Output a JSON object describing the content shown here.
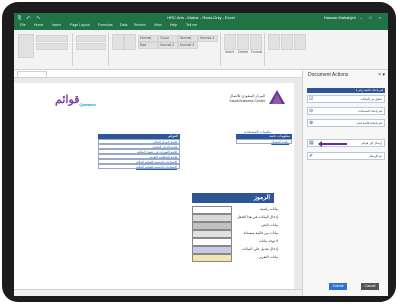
{
  "titlebar": {
    "title": "HRC Arts - Mahar - Read-Only - Excel",
    "user": "Hassan Mahabjeh",
    "qat": "⎘ ↶ ↷",
    "window_controls": "– □ ×"
  },
  "tabs": [
    "File",
    "Home",
    "Insert",
    "Page Layout",
    "Formulas",
    "Data",
    "Review",
    "View",
    "Help",
    "Tell me"
  ],
  "ribbon": {
    "style_boxes": [
      "Normal",
      "Bad",
      "Good",
      "Normal 2",
      "Normal",
      "Normal 3",
      "Normal 4"
    ],
    "cells_group": [
      "Insert",
      "Delete",
      "Format"
    ]
  },
  "logo": {
    "name": "قوائم",
    "tagline": "Qawaem"
  },
  "sbc": {
    "name_ar": "المركز السعودي للأعمال",
    "name_en": "Saudi Business Center",
    "link": "تعليمات المستخدم"
  },
  "left_table": {
    "header": "معلومات عامة",
    "row": "بيانات المنشأة"
  },
  "middle_table": {
    "header": "القوائم",
    "rows": [
      "قائمة المركز المالي",
      "قائمة الدخل الشامل",
      "قائمة التغيرات في حقوق الملكية",
      "قائمة التدفقات النقدية",
      "الإيضاحات المتممة للقوائم المالية",
      "الإيضاحات المتممة للقوائم المالية"
    ]
  },
  "legend": {
    "title": "الرموز",
    "items": [
      {
        "label": "بيانات رقمية",
        "color": "#ffffff"
      },
      {
        "label": "إدخال البيانات في هذا الحقل",
        "color": "#d9d9d9"
      },
      {
        "label": "بيانات النص",
        "color": "#c0c0c0"
      },
      {
        "label": "بيانات من قائمة منسدلة",
        "color": "#e0e0e0"
      },
      {
        "label": "لا توجد بيانات",
        "color": "#ffffff"
      },
      {
        "label": "إدخال تعديل على البيانات",
        "color": "#c8c8e8"
      },
      {
        "label": "بيانات التقرير",
        "color": "#f0e6b0"
      }
    ]
  },
  "pane": {
    "title": "Document Actions",
    "close": "× ▾",
    "bar": "قم بإعداد قائمة رقم 1",
    "actions": [
      {
        "icon": "☑",
        "label": "تحقق من البيانات",
        "icon_name": "checklist-icon"
      },
      {
        "icon": "⊖",
        "label": "قم بإعداد الحسابات",
        "icon_name": "minus-icon"
      },
      {
        "icon": "⊕",
        "label": "قم بإنشاء قائمة أصل",
        "icon_name": "plus-icon"
      },
      {
        "icon": "▤",
        "label": "إرسال إلى قوائم",
        "icon_name": "document-icon"
      },
      {
        "icon": "✔",
        "label": "تم الإرسال",
        "icon_name": "check-icon"
      }
    ],
    "buttons": [
      "Submit",
      "Cancel"
    ]
  }
}
